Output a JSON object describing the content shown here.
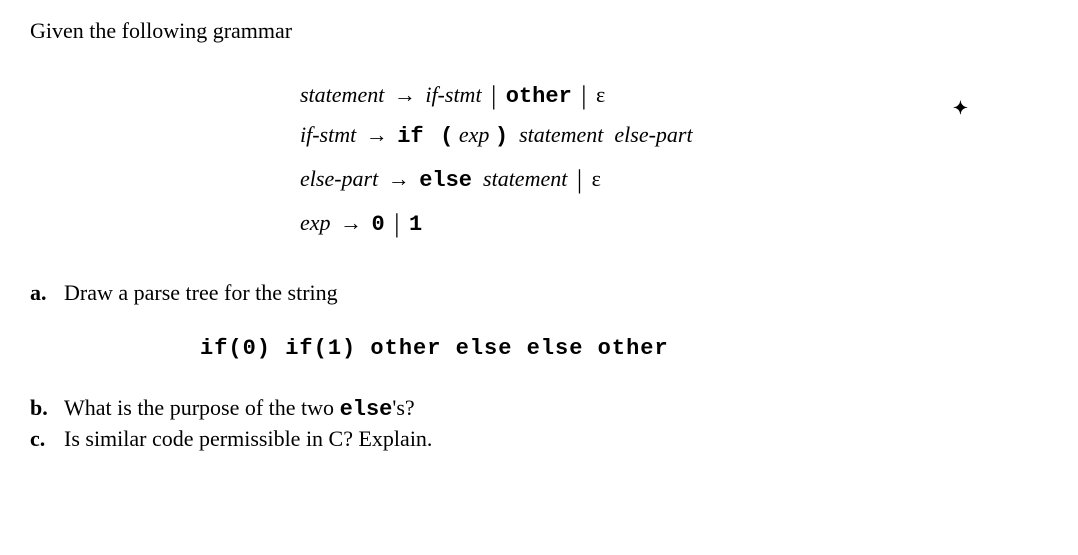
{
  "intro": "Given the following grammar",
  "grammar": {
    "r1": {
      "lhs": "statement",
      "rhs_nt1": "if-stmt",
      "rhs_term1": "other",
      "eps": "ε"
    },
    "r2": {
      "lhs": "if-stmt",
      "t_if": "if",
      "t_lp": "(",
      "nt_exp": "exp",
      "t_rp": ")",
      "nt_stmt": "statement",
      "nt_else": "else-part"
    },
    "r3": {
      "lhs": "else-part",
      "t_else": "else",
      "nt_stmt": "statement",
      "eps": "ε"
    },
    "r4": {
      "lhs": "exp",
      "t0": "0",
      "t1": "1"
    }
  },
  "questions": {
    "a": {
      "label": "a.",
      "text": "Draw a parse tree for the string"
    },
    "code": "if(0) if(1) other else else other",
    "b": {
      "label": "b.",
      "text_pre": "What is the purpose of the two ",
      "text_code": "else",
      "text_post": "'s?"
    },
    "c": {
      "label": "c.",
      "text": "Is similar code permissible in C? Explain."
    }
  },
  "mark": "✦"
}
